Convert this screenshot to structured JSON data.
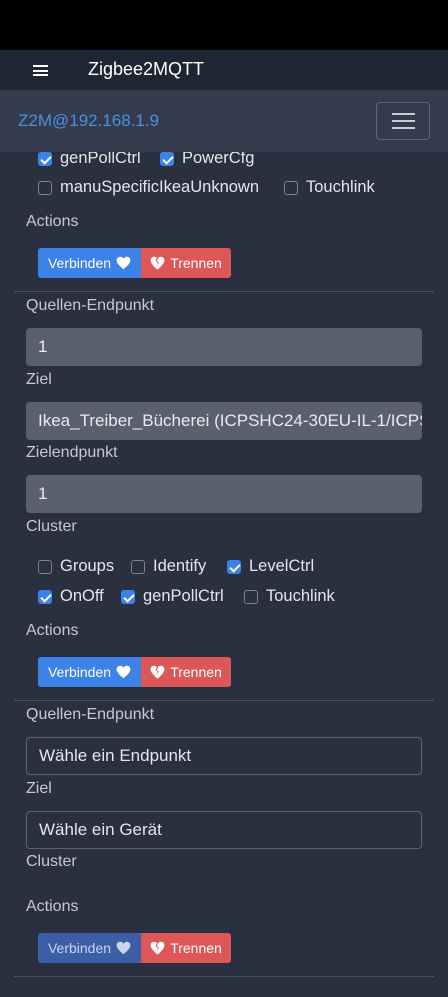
{
  "app": {
    "title": "Zigbee2MQTT"
  },
  "navbar": {
    "brand": "Z2M@192.168.1.9"
  },
  "labels": {
    "actions": "Actions",
    "source_endpoint": "Quellen-Endpunkt",
    "target": "Ziel",
    "target_endpoint": "Zielendpunkt",
    "cluster": "Cluster",
    "connect": "Verbinden",
    "disconnect": "Trennen"
  },
  "binding1": {
    "clusters": [
      {
        "name": "genPollCtrl",
        "checked": true
      },
      {
        "name": "PowerCfg",
        "checked": true
      },
      {
        "name": "manuSpecificIkeaUnknown",
        "checked": false
      },
      {
        "name": "Touchlink",
        "checked": false
      }
    ]
  },
  "binding2": {
    "source_endpoint": "1",
    "target": "Ikea_Treiber_Bücherei (ICPSHC24-30EU-IL-1/ICPS",
    "target_endpoint": "1",
    "clusters": [
      {
        "name": "Groups",
        "checked": false
      },
      {
        "name": "Identify",
        "checked": false
      },
      {
        "name": "LevelCtrl",
        "checked": true
      },
      {
        "name": "OnOff",
        "checked": true
      },
      {
        "name": "genPollCtrl",
        "checked": true
      },
      {
        "name": "Touchlink",
        "checked": false
      }
    ]
  },
  "binding3": {
    "source_endpoint_placeholder": "Wähle ein Endpunkt",
    "target_placeholder": "Wähle ein Gerät"
  },
  "colors": {
    "accent": "#3d82e6",
    "danger": "#dd5757",
    "background": "#2b3040",
    "navbar": "#343b4c"
  }
}
